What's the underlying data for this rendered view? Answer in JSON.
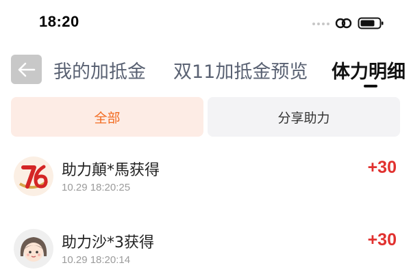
{
  "status_bar": {
    "time": "18:20",
    "icons": [
      "signal-dots-icon",
      "link-icon",
      "battery-icon"
    ]
  },
  "header": {
    "back_icon": "arrow-left-icon",
    "tabs": [
      {
        "label": "我的加抵金",
        "active": false
      },
      {
        "label": "双11加抵金预览",
        "active": false
      },
      {
        "label": "体力明细",
        "active": true
      }
    ]
  },
  "filters": [
    {
      "label": "全部",
      "active": true
    },
    {
      "label": "分享助力",
      "active": false
    }
  ],
  "records": [
    {
      "title": "助力顛*馬获得",
      "time": "10.29 18:20:25",
      "amount": "+30",
      "avatar": "76-logo-avatar"
    },
    {
      "title": "助力沙*3获得",
      "time": "10.29 18:20:14",
      "amount": "+30",
      "avatar": "girl-cartoon-avatar"
    }
  ],
  "colors": {
    "accent": "#f26b21",
    "accent_bg": "#fdece5",
    "amount": "#e1312f",
    "muted": "#9b9b9b",
    "tab_inactive": "#5a6273"
  }
}
